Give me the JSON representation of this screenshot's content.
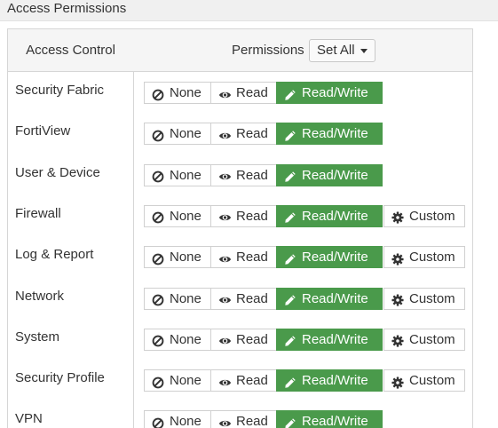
{
  "section": {
    "title": "Access Permissions"
  },
  "table": {
    "col_access": "Access Control",
    "col_permissions": "Permissions",
    "set_all_label": "Set All",
    "buttons": {
      "none": "None",
      "read": "Read",
      "read_write": "Read/Write",
      "custom": "Custom"
    },
    "rows": [
      {
        "label": "Security Fabric",
        "selected": "Read/Write",
        "has_custom": false
      },
      {
        "label": "FortiView",
        "selected": "Read/Write",
        "has_custom": false
      },
      {
        "label": "User & Device",
        "selected": "Read/Write",
        "has_custom": false
      },
      {
        "label": "Firewall",
        "selected": "Read/Write",
        "has_custom": true
      },
      {
        "label": "Log & Report",
        "selected": "Read/Write",
        "has_custom": true
      },
      {
        "label": "Network",
        "selected": "Read/Write",
        "has_custom": true
      },
      {
        "label": "System",
        "selected": "Read/Write",
        "has_custom": true
      },
      {
        "label": "Security Profile",
        "selected": "Read/Write",
        "has_custom": true
      },
      {
        "label": "VPN",
        "selected": "Read/Write",
        "has_custom": false
      }
    ]
  },
  "colors": {
    "selected": "#4a9a4b",
    "header_bg": "#f5f5f5",
    "border": "#d6d6d6"
  },
  "icons": {
    "none": "ban-icon",
    "read": "eye-icon",
    "read_write": "pencil-icon",
    "custom": "gear-icon"
  }
}
